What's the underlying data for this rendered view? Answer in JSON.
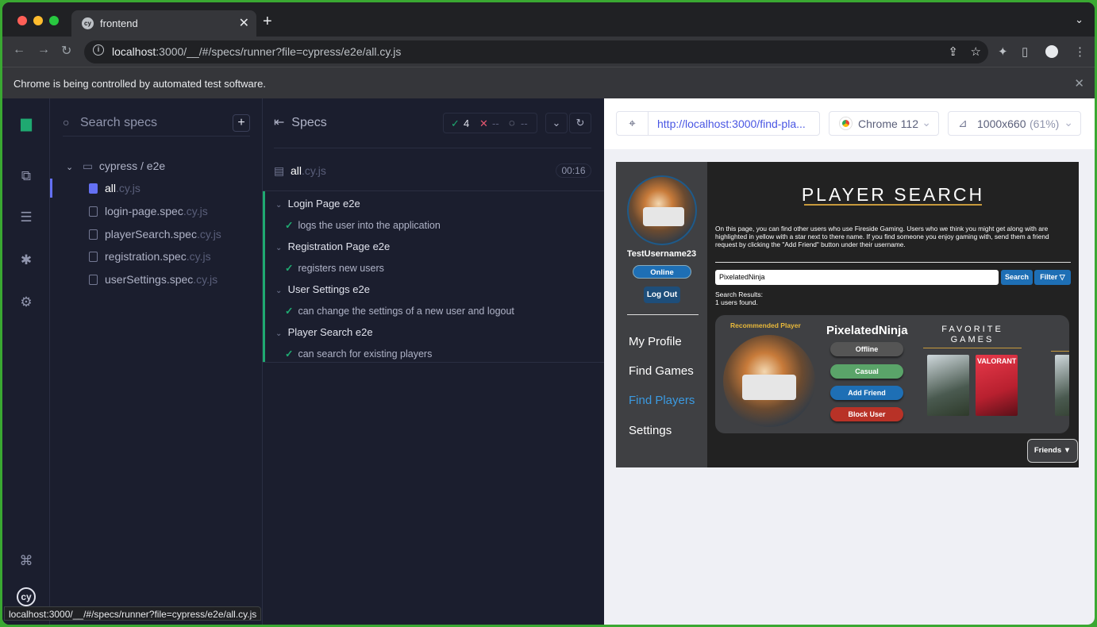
{
  "browser": {
    "tab_title": "frontend",
    "url_host": "localhost",
    "url_rest": ":3000/__/#/specs/runner?file=cypress/e2e/all.cy.js",
    "infobar_text": "Chrome is being controlled by automated test software.",
    "status_url": "localhost:3000/__/#/specs/runner?file=cypress/e2e/all.cy.js"
  },
  "specs": {
    "search_placeholder": "Search specs",
    "folder": "cypress / e2e",
    "files": [
      {
        "name": "all",
        "ext": ".cy.js"
      },
      {
        "name": "login-page.spec",
        "ext": ".cy.js"
      },
      {
        "name": "playerSearch.spec",
        "ext": ".cy.js"
      },
      {
        "name": "registration.spec",
        "ext": ".cy.js"
      },
      {
        "name": "userSettings.spec",
        "ext": ".cy.js"
      }
    ]
  },
  "reporter": {
    "heading": "Specs",
    "passed": "4",
    "failed": "--",
    "pending": "--",
    "spec_name": "all",
    "spec_ext": ".cy.js",
    "duration": "00:16",
    "suites": [
      {
        "title": "Login Page e2e",
        "test": "logs the user into the application"
      },
      {
        "title": "Registration Page e2e",
        "test": "registers new users"
      },
      {
        "title": "User Settings e2e",
        "test": "can change the settings of a new user and logout"
      },
      {
        "title": "Player Search e2e",
        "test": "can search for existing players"
      }
    ]
  },
  "aut": {
    "url": "http://localhost:3000/find-pla...",
    "browser": "Chrome 112",
    "viewport": "1000x660",
    "scale": "(61%)"
  },
  "app": {
    "username": "TestUsername23",
    "status_btn": "Online",
    "logout_btn": "Log Out",
    "nav": [
      "My Profile",
      "Find Games",
      "Find Players",
      "Settings"
    ],
    "page_title": "PLAYER SEARCH",
    "description": "On this page, you can find other users who use Fireside Gaming. Users who we think you might get along with are highlighted in yellow with a star next to there name. If you find someone you enjoy gaming with, send them a friend request by clicking the \"Add Friend\" button under their username.",
    "search_value": "PixelatedNinja",
    "search_btn": "Search",
    "filter_btn": "Filter ▽",
    "results_label": "Search Results:",
    "results_count": "1 users found.",
    "rec_label": "Recommended Player",
    "player_name": "PixelatedNinja",
    "player_status": "Offline",
    "player_mode": "Casual",
    "add_friend": "Add Friend",
    "block_user": "Block User",
    "fav_games": "FAVORITE GAMES",
    "game2": "VALORANT",
    "friends_btn": "Friends ▼",
    "colors": {
      "accent": "#1e6fb5",
      "active_nav": "#3b9ae1",
      "green": "#5aa469",
      "red": "#b83227",
      "gold": "#c79a3c"
    }
  }
}
